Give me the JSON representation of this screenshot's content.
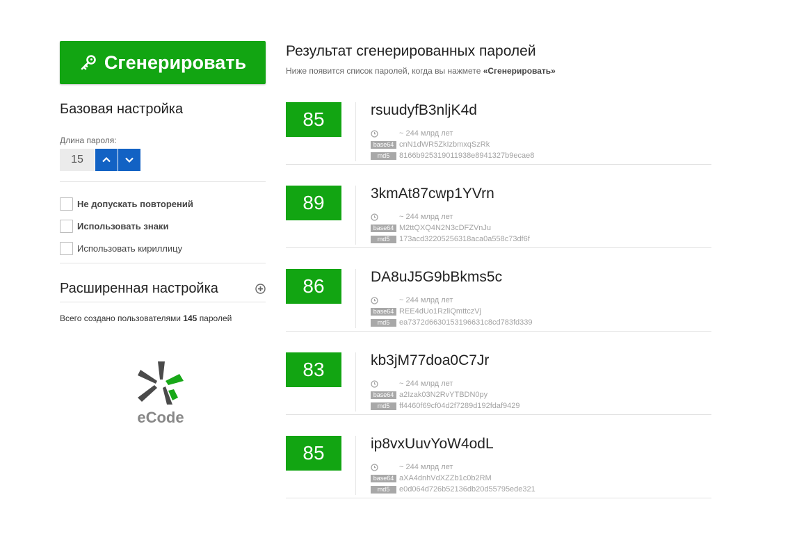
{
  "generate_button": {
    "label": "Сгенерировать",
    "icon": "key-icon"
  },
  "basic": {
    "title": "Базовая настройка",
    "length_label": "Длина пароля:",
    "length_value": "15"
  },
  "options": [
    {
      "label": "Не допускать повторений",
      "checked": false,
      "bold": true
    },
    {
      "label": "Использовать знаки",
      "checked": false,
      "bold": true
    },
    {
      "label": "Использовать кириллицу",
      "checked": false,
      "bold": false
    }
  ],
  "advanced": {
    "title": "Расширенная настройка"
  },
  "stats": {
    "prefix": "Всего создано пользователями",
    "count": "145",
    "suffix": "паролей"
  },
  "logo": {
    "text": "eCode"
  },
  "results": {
    "title": "Результат сгенерированных паролей",
    "subtitle_prefix": "Ниже появится список паролей, когда вы нажмете",
    "subtitle_bold": "«Сгенерировать»",
    "tag_base64": "base64",
    "tag_md5": "md5",
    "items": [
      {
        "score": "85",
        "password": "rsuudyfB3nljK4d",
        "time": "~ 244 млрд лет",
        "base64": "cnN1dWR5ZkIzbmxqSzRk",
        "md5": "8166b925319011938e8941327b9ecae8"
      },
      {
        "score": "89",
        "password": "3kmAt87cwp1YVrn",
        "time": "~ 244 млрд лет",
        "base64": "M2ttQXQ4N2N3cDFZVnJu",
        "md5": "173acd32205256318aca0a558c73df6f"
      },
      {
        "score": "86",
        "password": "DA8uJ5G9bBkms5c",
        "time": "~ 244 млрд лет",
        "base64": "REE4dUo1RzliQmttczVj",
        "md5": "ea7372d6630153196631c8cd783fd339"
      },
      {
        "score": "83",
        "password": "kb3jM77doa0C7Jr",
        "time": "~ 244 млрд лет",
        "base64": "a2Izak03N2RvYTBDN0py",
        "md5": "ff4460f69cf04d2f7289d192fdaf9429"
      },
      {
        "score": "85",
        "password": "ip8vxUuvYoW4odL",
        "time": "~ 244 млрд лет",
        "base64": "aXA4dnhVdXZZb1c0b2RM",
        "md5": "e0d064d726b52136db20d55795ede321"
      }
    ]
  },
  "colors": {
    "accent_green": "#12a512",
    "accent_blue": "#1262c4"
  }
}
